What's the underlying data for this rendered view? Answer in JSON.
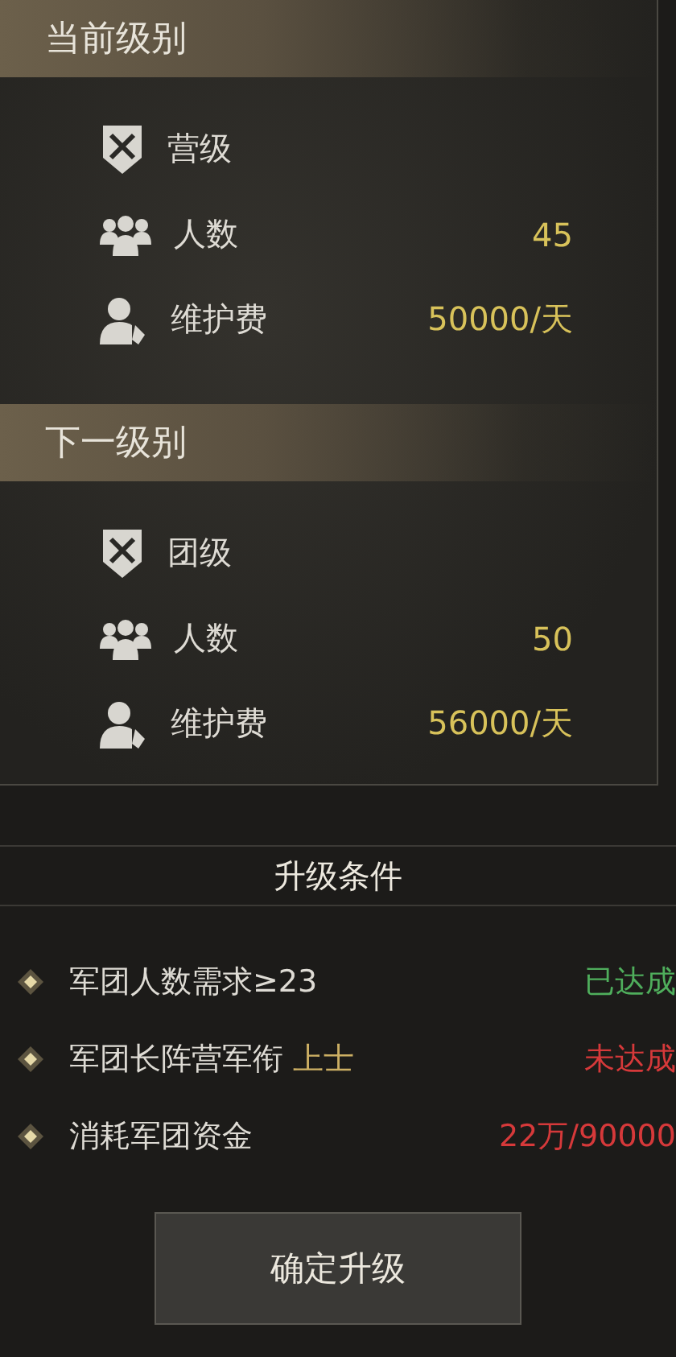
{
  "sections": [
    {
      "title": "当前级别",
      "rows": [
        {
          "kind": "level",
          "label": "营级"
        },
        {
          "kind": "members",
          "label": "人数",
          "value": "45"
        },
        {
          "kind": "upkeep",
          "label": "维护费",
          "value": "50000/天"
        }
      ]
    },
    {
      "title": "下一级别",
      "rows": [
        {
          "kind": "level",
          "label": "团级"
        },
        {
          "kind": "members",
          "label": "人数",
          "value": "50"
        },
        {
          "kind": "upkeep",
          "label": "维护费",
          "value": "56000/天"
        }
      ]
    }
  ],
  "conditions": {
    "title": "升级条件",
    "items": [
      {
        "label": "军团人数需求≥23",
        "status": "已达成",
        "met": true
      },
      {
        "label": "军团长阵营军衔",
        "highlight": "上士",
        "status": "未达成",
        "met": false
      },
      {
        "label": "消耗军团资金",
        "status": "22万/90000",
        "met": false
      }
    ]
  },
  "button": "确定升级"
}
